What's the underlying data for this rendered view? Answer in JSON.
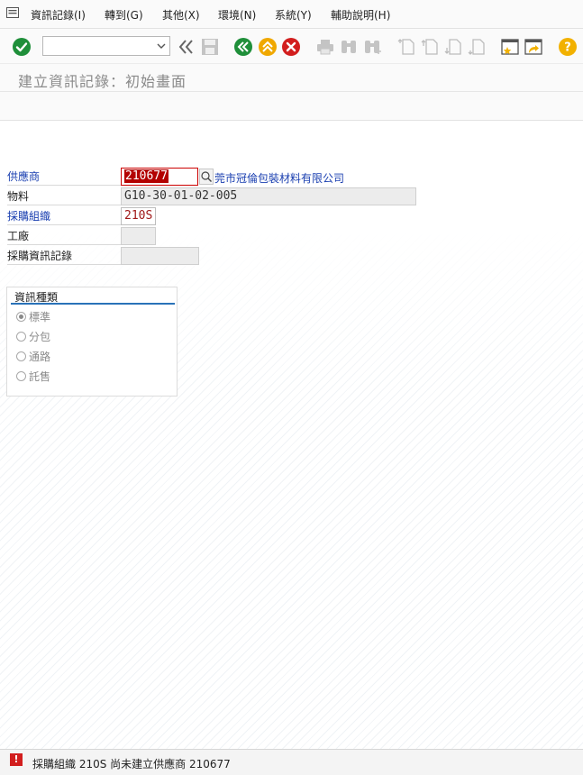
{
  "menu": {
    "items": [
      {
        "label": "資訊記錄(I)"
      },
      {
        "label": "轉到(G)"
      },
      {
        "label": "其他(X)"
      },
      {
        "label": "環境(N)"
      },
      {
        "label": "系統(Y)"
      },
      {
        "label": "輔助說明(H)"
      }
    ]
  },
  "toolbar": {
    "command_value": "",
    "icons": [
      "enter-check-icon",
      "double-left-chevron-icon",
      "save-icon",
      "back-icon",
      "exit-icon",
      "cancel-icon",
      "print-icon",
      "find-icon",
      "find-next-icon",
      "first-page-icon",
      "previous-page-icon",
      "next-page-icon",
      "last-page-icon",
      "create-session-icon",
      "shortcut-icon",
      "help-icon"
    ]
  },
  "page": {
    "title": "建立資訊記錄：初始畫面"
  },
  "form": {
    "vendor": {
      "label": "供應商",
      "value": "210677",
      "description": "莞市冠倫包裝材料有限公司"
    },
    "material": {
      "label": "物料",
      "value": "G10-30-01-02-005"
    },
    "purch_org": {
      "label": "採購組織",
      "value": "210S"
    },
    "plant": {
      "label": "工廠",
      "value": ""
    },
    "info_record": {
      "label": "採購資訊記錄",
      "value": ""
    }
  },
  "info_category": {
    "title": "資訊種類",
    "options": [
      {
        "label": "標準",
        "selected": true
      },
      {
        "label": "分包",
        "selected": false
      },
      {
        "label": "通路",
        "selected": false
      },
      {
        "label": "託售",
        "selected": false
      }
    ]
  },
  "status": {
    "type": "error",
    "icon_text": "!",
    "message": "採購組織 210S 尚未建立供應商 210677"
  },
  "colors": {
    "link_label": "#1a3fb0",
    "error_red": "#d21e1e",
    "enter_green": "#1f8f3a",
    "back_green": "#1f8f3a",
    "exit_orange": "#f0a800",
    "cancel_red": "#d21e1e",
    "help_yellow": "#f2b100"
  }
}
